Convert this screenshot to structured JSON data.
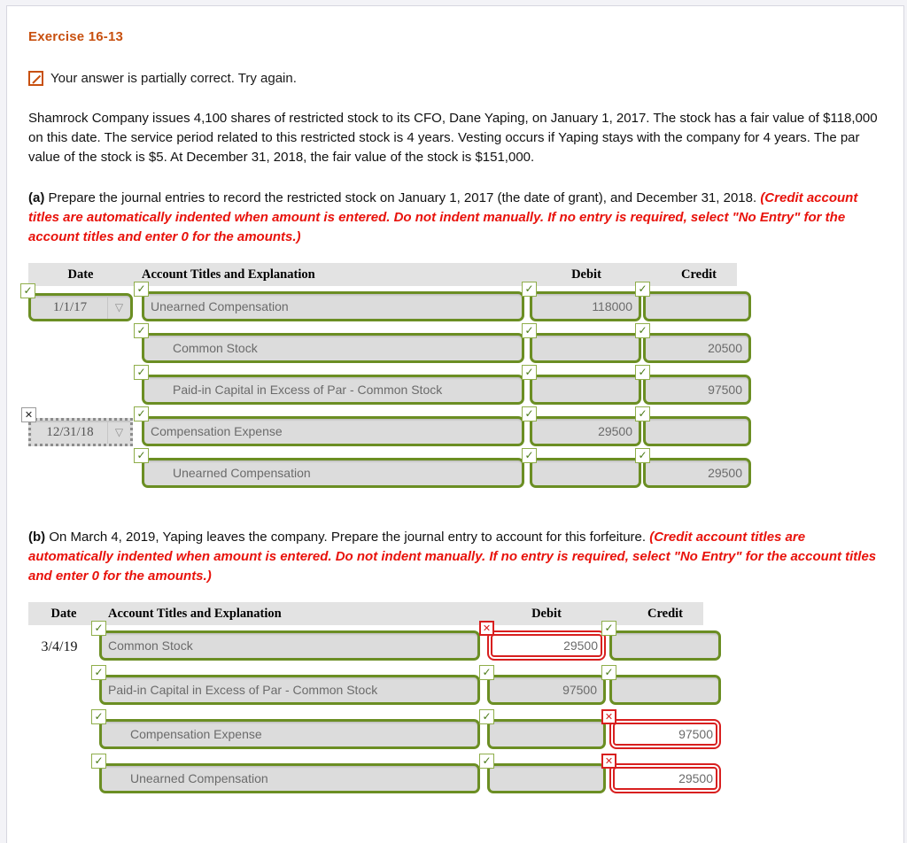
{
  "exercise": {
    "title": "Exercise 16-13"
  },
  "status": {
    "icon": "partially-correct-icon",
    "message": "Your answer is partially correct.  Try again."
  },
  "problem": {
    "text": "Shamrock Company issues 4,100 shares of restricted stock to its CFO, Dane Yaping, on January 1, 2017. The stock has a fair value of $118,000 on this date. The service period related to this restricted stock is 4 years. Vesting occurs if Yaping stays with the company for 4 years. The par value of the stock is $5. At December 31, 2018, the fair value of the stock is $151,000."
  },
  "part_a": {
    "label": "(a)",
    "prompt": " Prepare the journal entries to record the restricted stock on January 1, 2017 (the date of grant), and December 31, 2018. ",
    "note": "(Credit account titles are automatically indented when amount is entered. Do not indent manually. If no entry is required, select \"No Entry\" for the account titles and enter 0 for the amounts.)",
    "table": {
      "columns": [
        "Date",
        "Account Titles and Explanation",
        "Debit",
        "Credit"
      ],
      "rows": [
        {
          "date": "1/1/17",
          "date_type": "select",
          "date_status": "correct",
          "account": "Unearned Compensation",
          "account_status": "correct",
          "indent": false,
          "debit": "118000",
          "debit_status": "correct",
          "credit": "",
          "credit_status": "correct"
        },
        {
          "date": "",
          "date_type": "none",
          "date_status": "",
          "account": "Common Stock",
          "account_status": "correct",
          "indent": true,
          "debit": "",
          "debit_status": "correct",
          "credit": "20500",
          "credit_status": "correct"
        },
        {
          "date": "",
          "date_type": "none",
          "date_status": "",
          "account": "Paid-in Capital in Excess of Par - Common Stock",
          "account_status": "correct",
          "indent": true,
          "debit": "",
          "debit_status": "correct",
          "credit": "97500",
          "credit_status": "correct"
        },
        {
          "date": "12/31/18",
          "date_type": "select",
          "date_status": "incorrect",
          "account": "Compensation Expense",
          "account_status": "correct",
          "indent": false,
          "debit": "29500",
          "debit_status": "correct",
          "credit": "",
          "credit_status": "correct"
        },
        {
          "date": "",
          "date_type": "none",
          "date_status": "",
          "account": "Unearned Compensation",
          "account_status": "correct",
          "indent": true,
          "debit": "",
          "debit_status": "correct",
          "credit": "29500",
          "credit_status": "correct"
        }
      ]
    }
  },
  "part_b": {
    "label": "(b)",
    "prompt": " On March 4, 2019, Yaping leaves the company. Prepare the journal entry to account for this forfeiture. ",
    "note": "(Credit account titles are automatically indented when amount is entered. Do not indent manually. If no entry is required, select \"No Entry\" for the account titles and enter 0 for the amounts.)",
    "table": {
      "columns": [
        "Date",
        "Account Titles and Explanation",
        "Debit",
        "Credit"
      ],
      "rows": [
        {
          "date": "3/4/19",
          "date_type": "text",
          "date_status": "",
          "account": "Common Stock",
          "account_status": "correct",
          "indent": false,
          "debit": "29500",
          "debit_status": "incorrect",
          "credit": "",
          "credit_status": "correct"
        },
        {
          "date": "",
          "date_type": "none",
          "date_status": "",
          "account": "Paid-in Capital in Excess of Par - Common Stock",
          "account_status": "correct",
          "indent": false,
          "debit": "97500",
          "debit_status": "correct",
          "credit": "",
          "credit_status": "correct"
        },
        {
          "date": "",
          "date_type": "none",
          "date_status": "",
          "account": "Compensation Expense",
          "account_status": "correct",
          "indent": true,
          "debit": "",
          "debit_status": "correct",
          "credit": "97500",
          "credit_status": "incorrect"
        },
        {
          "date": "",
          "date_type": "none",
          "date_status": "",
          "account": "Unearned Compensation",
          "account_status": "correct",
          "indent": true,
          "debit": "",
          "debit_status": "correct",
          "credit": "29500",
          "credit_status": "incorrect"
        }
      ]
    }
  },
  "icons": {
    "check": "✓",
    "cross": "✕",
    "dropdown_arrow": "▽"
  },
  "colors": {
    "title": "#c8500f",
    "note": "#e8120b",
    "correct_border": "#6b8e23",
    "error_border": "#d81f1f",
    "field_fill": "#dcdcdc",
    "header_fill": "#e3e3e3"
  }
}
